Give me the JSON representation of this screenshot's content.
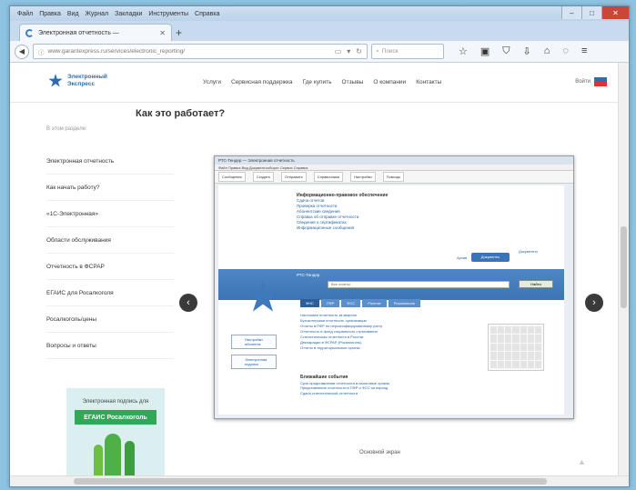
{
  "browser": {
    "menu": [
      "Файл",
      "Правка",
      "Вид",
      "Журнал",
      "Закладки",
      "Инструменты",
      "Справка"
    ],
    "tab_title": "Электронная отчетность —",
    "url": "www.garantexpress.ru/services/electronic_reporting/",
    "search_placeholder": "Поиск"
  },
  "site": {
    "logo_line1": "Электронный",
    "logo_line2": "Экспресс",
    "nav": [
      "Услуги",
      "Сервисная поддержка",
      "Где купить",
      "Отзывы",
      "О компании",
      "Контакты"
    ],
    "user": "Войти"
  },
  "page": {
    "title": "Как это работает?",
    "sidebar_subtitle": "В этом разделе:",
    "sidebar_items": [
      "Электронная отчетность",
      "Как начать работу?",
      "«1С-Электронная»",
      "Области обслуживания",
      "Отчетность в ФСРАР",
      "ЕГАИС для Росалкоголя",
      "Росалкоголь/цены",
      "Вопросы и ответы"
    ],
    "promo_text": "Электронная подпись для",
    "promo_badge": "ЕГАИС Росалкоголь",
    "bottom_text": "Основной экран"
  },
  "inner_screenshot": {
    "title": "РТС-Тендер — Электронная отчетность",
    "menu": "Файл  Правка  Вид  Документооборот  Сервис  Справка",
    "tools": [
      "Сообщения",
      "Создать",
      "Отправить",
      "Справочники",
      "Настройки",
      "Помощь"
    ],
    "info_heading": "Информационно-правовое обеспечение",
    "info_links": [
      "Сдача отчетов",
      "Проверка отчетности",
      "Абонентские сведения",
      "Справка об отправке отчетности",
      "Сведения о сертификатах",
      "Информационные сообщения"
    ],
    "doc_button": "Документы",
    "doc_link": "Документы",
    "doc_link0": "Архив",
    "band_title": "РТС-Тендер",
    "band_select": "Все отчеты",
    "band_go": "Найти",
    "subtabs": [
      "ФНС",
      "ПФР",
      "ФСС",
      "Росстат",
      "Росалкоголь"
    ],
    "listing": [
      "Налоговая отчетность за квартал",
      "Бухгалтерская отчетность организации",
      "Отчеты в ПФР по персонифицированному учету",
      "Отчетность в фонд социального страхования",
      "Статистическая отчетность в Росстат",
      "Декларации в ФСРАР (Росалкоголь)",
      "Отчеты в территориальные органы"
    ],
    "side_boxes": [
      "Настройки абонента",
      "Электронная подпись"
    ],
    "news_heading": "Ближайшие события",
    "news_lines": [
      "Срок представления отчетности в налоговые органы",
      "Представление отчетности в ПФР и ФСС за период",
      "Сдача статистической отчетности"
    ]
  }
}
